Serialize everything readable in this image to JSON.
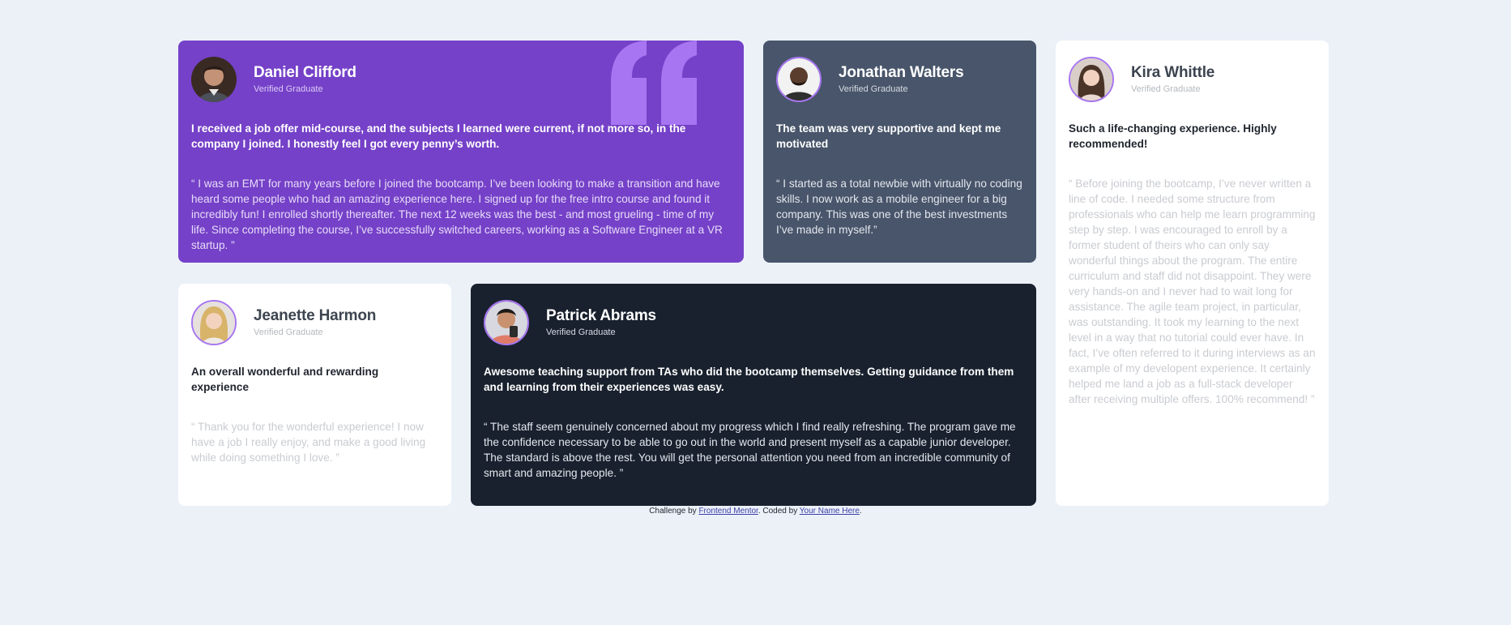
{
  "testimonials": [
    {
      "name": "Daniel Clifford",
      "tag": "Verified Graduate",
      "headline": "I received a job offer mid-course, and the subjects I learned were current, if not more so, in the company I joined. I honestly feel I got every penny’s worth.",
      "body": "“ I was an EMT for many years before I joined the bootcamp. I’ve been looking to make a transition and have heard some people who had an amazing experience here. I signed up for the free intro course and found it incredibly fun! I enrolled shortly thereafter. The next 12 weeks was the best - and most grueling - time of my life. Since completing the course, I’ve successfully switched careers, working as a Software Engineer at a VR startup. ”"
    },
    {
      "name": "Jonathan Walters",
      "tag": "Verified Graduate",
      "headline": "The team was very supportive and kept me motivated",
      "body": "“ I started as a total newbie with virtually no coding skills. I now work as a mobile engineer for a big company. This was one of the best investments I’ve made in myself.”"
    },
    {
      "name": "Kira Whittle",
      "tag": "Verified Graduate",
      "headline": "Such a life-changing experience. Highly recommended!",
      "body": "“ Before joining the bootcamp, I’ve never written a line of code. I needed some structure from professionals who can help me learn programming step by step. I was encouraged to enroll by a former student of theirs who can only say wonderful things about the program. The entire curriculum and staff did not disappoint. They were very hands-on and I never had to wait long for assistance. The agile team project, in particular, was outstanding. It took my learning to the next level in a way that no tutorial could ever have. In fact, I’ve often referred to it during interviews as an example of my developent experience. It certainly helped me land a job as a full-stack developer after receiving multiple offers. 100% recommend! ”"
    },
    {
      "name": "Jeanette Harmon",
      "tag": "Verified Graduate",
      "headline": "An overall wonderful and rewarding experience",
      "body": "“ Thank you for the wonderful experience! I now have a job I really enjoy, and make a good living while doing something I love. ”"
    },
    {
      "name": "Patrick Abrams",
      "tag": "Verified Graduate",
      "headline": "Awesome teaching support from TAs who did the bootcamp themselves. Getting guidance from them and learning from their experiences was easy.",
      "body": "“ The staff seem genuinely concerned about my progress which I find really refreshing. The program gave me the confidence necessary to be able to go out in the world and present myself as a capable junior developer. The standard is above the rest. You will get the personal attention you need from an incredible community of smart and amazing people. ”"
    }
  ],
  "attribution": {
    "prefix": "Challenge by ",
    "link1": "Frontend Mentor",
    "middle": ". Coded by ",
    "link2": "Your Name Here",
    "suffix": "."
  },
  "colors": {
    "page_bg": "#ecf1f8",
    "purple_card": "#7541c8",
    "slate_card": "#48556a",
    "dark_card": "#19212e",
    "white_card": "#ffffff",
    "quote_mark": "#a775f1"
  },
  "icons": [
    "quote-mark-icon"
  ]
}
